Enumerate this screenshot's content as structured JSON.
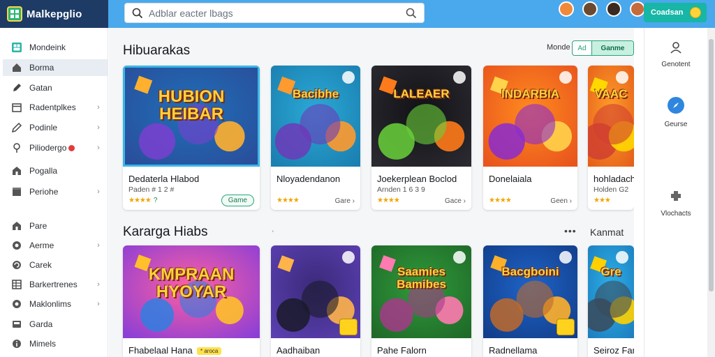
{
  "app": {
    "title": "Malkepglio"
  },
  "search": {
    "placeholder": "Adblar eacter lbags"
  },
  "top_button": {
    "label": "Coadsan"
  },
  "colors": {
    "topbar": "#4aa8ec",
    "logo_bg": "#1e3b66",
    "accent": "#17b6a6",
    "segment_accent": "#2aa37a"
  },
  "sidebar": {
    "items": [
      {
        "label": "Mondeink",
        "icon": "grid-icon",
        "chevron": false
      },
      {
        "label": "Borma",
        "icon": "home-icon",
        "chevron": false,
        "active": true
      },
      {
        "label": "Gatan",
        "icon": "pen-icon",
        "chevron": false
      },
      {
        "label": "Radentplkes",
        "icon": "calendar-icon",
        "chevron": true
      },
      {
        "label": "Podinle",
        "icon": "pencil-icon",
        "chevron": true
      },
      {
        "label": "Piliodergo",
        "icon": "pin-icon",
        "chevron": true,
        "dot": true
      },
      {
        "label": "Pogalla",
        "icon": "house-icon",
        "chevron": false
      },
      {
        "label": "Periohe",
        "icon": "box-icon",
        "chevron": true
      },
      {
        "label": "Pare",
        "icon": "house-icon",
        "chevron": false
      },
      {
        "label": "Aerme",
        "icon": "circle-icon",
        "chevron": true
      },
      {
        "label": "Carek",
        "icon": "refresh-icon",
        "chevron": false
      },
      {
        "label": "Barkertrenes",
        "icon": "table-icon",
        "chevron": true
      },
      {
        "label": "Maklonlims",
        "icon": "circle-icon",
        "chevron": true
      },
      {
        "label": "Garda",
        "icon": "card-icon",
        "chevron": false
      },
      {
        "label": "Mimels",
        "icon": "info-icon",
        "chevron": false
      }
    ]
  },
  "right_panel": {
    "items": [
      {
        "label": "Genotent",
        "icon": "user-icon"
      },
      {
        "label": "Geurse",
        "icon": "compass-icon"
      },
      {
        "label": "Vlochacts",
        "icon": "puzzle-icon"
      }
    ]
  },
  "sections": [
    {
      "title": "Hibuarakas",
      "mode_label": "Monde",
      "segment": {
        "left": "Ad",
        "right": "Ganme"
      },
      "cards": [
        {
          "art_text": "HUBION HEIBAR",
          "title": "Dedaterla Hlabod",
          "subtitle": "Paden # 1 2 #",
          "rating": "★★★★",
          "rating_extra": "?",
          "button": "Game",
          "button_style": "pill",
          "selected": true
        },
        {
          "art_text": "Bacibhe",
          "title": "Nloyadendanon",
          "subtitle": "",
          "rating": "★★★★",
          "button": "Gare ›",
          "button_style": "text"
        },
        {
          "art_text": "LALEAER",
          "title": "Joekerplean Boclod",
          "subtitle": "Arnden 1 6 3 9",
          "rating": "★★★★",
          "button": "Gace ›",
          "button_style": "text"
        },
        {
          "art_text": "INDARBIA",
          "title": "Donelaiala",
          "subtitle": "",
          "rating": "★★★★",
          "button": "Geen ›",
          "button_style": "text"
        },
        {
          "art_text": "VAAC",
          "title": "hohladache",
          "subtitle": "Holden G2",
          "rating": "★★★",
          "button": "",
          "button_style": "text"
        }
      ]
    },
    {
      "title": "Kararga Hiabs",
      "more": "•••",
      "view_all": "Kanmat",
      "tick": "˒",
      "cards": [
        {
          "art_text": "KMPRAAN HYOYAR",
          "title": "Fhabelaal Hana",
          "badge": "* aroca",
          "button_style": "none"
        },
        {
          "art_text": "",
          "title": "Aadhaiban",
          "button_style": "none"
        },
        {
          "art_text": "Saamies Bamibes",
          "title": "Pahe Falorn",
          "button_style": "none"
        },
        {
          "art_text": "Bacgboini",
          "title": "Radnellama",
          "button_style": "none"
        },
        {
          "art_text": "Gre",
          "title": "Seiroz Fan",
          "button_style": "none"
        }
      ]
    }
  ]
}
